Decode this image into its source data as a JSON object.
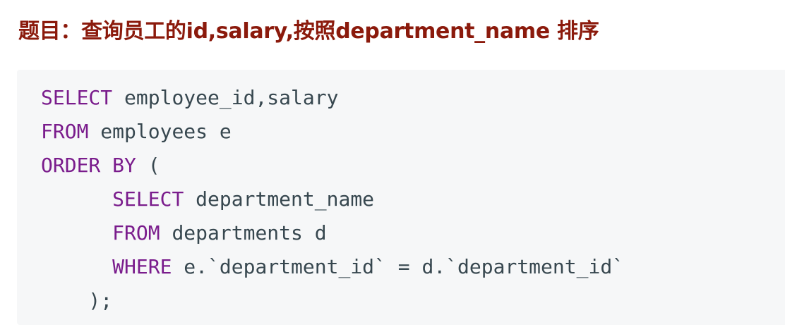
{
  "heading": {
    "text": "题目：查询员工的id,salary,按照department_name 排序",
    "color": "#8b1a0c"
  },
  "code": {
    "keyword_color": "#7a1c8c",
    "text_color": "#37474f",
    "lines": [
      [
        {
          "t": "SELECT",
          "k": true
        },
        {
          "t": " employee_id,salary",
          "k": false
        }
      ],
      [
        {
          "t": "FROM",
          "k": true
        },
        {
          "t": " employees e",
          "k": false
        }
      ],
      [
        {
          "t": "ORDER BY",
          "k": true
        },
        {
          "t": " (",
          "k": false
        }
      ],
      [
        {
          "t": "      ",
          "k": false
        },
        {
          "t": "SELECT",
          "k": true
        },
        {
          "t": " department_name",
          "k": false
        }
      ],
      [
        {
          "t": "      ",
          "k": false
        },
        {
          "t": "FROM",
          "k": true
        },
        {
          "t": " departments d",
          "k": false
        }
      ],
      [
        {
          "t": "      ",
          "k": false
        },
        {
          "t": "WHERE",
          "k": true
        },
        {
          "t": " e.`department_id` = d.`department_id`",
          "k": false
        }
      ],
      [
        {
          "t": "    );",
          "k": false
        }
      ]
    ]
  }
}
